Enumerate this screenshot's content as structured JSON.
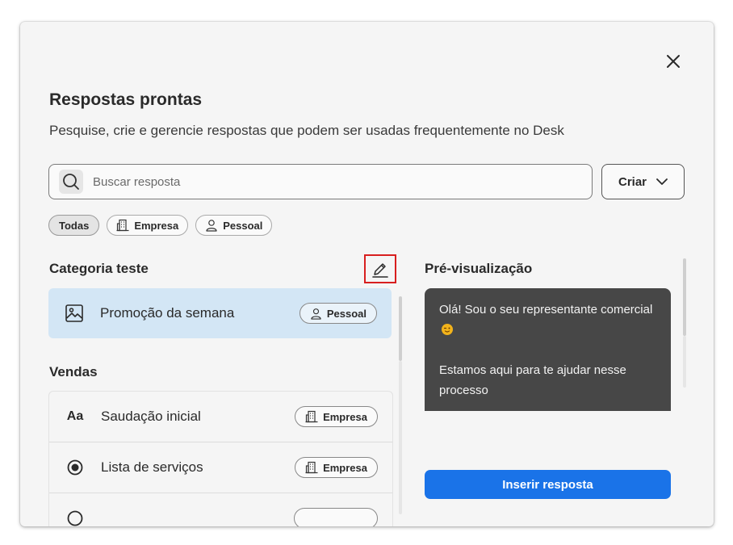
{
  "header": {
    "title": "Respostas prontas",
    "subtitle": "Pesquise, crie e gerencie respostas que podem ser usadas frequentemente no Desk"
  },
  "search": {
    "placeholder": "Buscar resposta",
    "value": ""
  },
  "create_button": {
    "label": "Criar"
  },
  "filters": [
    {
      "label": "Todas",
      "active": true
    },
    {
      "label": "Empresa",
      "icon": "building-icon"
    },
    {
      "label": "Pessoal",
      "icon": "person-icon"
    }
  ],
  "categories": [
    {
      "title": "Categoria teste",
      "items": [
        {
          "label": "Promoção da semana",
          "icon": "image-icon",
          "badge": "Pessoal",
          "badge_icon": "person-icon",
          "selected": true
        }
      ]
    },
    {
      "title": "Vendas",
      "items": [
        {
          "label": "Saudação inicial",
          "icon": "text-aa-icon",
          "badge": "Empresa",
          "badge_icon": "building-icon"
        },
        {
          "label": "Lista de serviços",
          "icon": "radio-icon",
          "badge": "Empresa",
          "badge_icon": "building-icon"
        }
      ]
    }
  ],
  "preview": {
    "title": "Pré-visualização",
    "paragraph1": "Olá! Sou o seu representante comercial",
    "paragraph2": "Estamos aqui para te ajudar nesse processo",
    "emoji_icon": "winking-face-icon"
  },
  "insert_button": {
    "label": "Inserir resposta"
  },
  "colors": {
    "accent": "#1a73e8",
    "selected_bg": "#d3e6f5",
    "preview_bg": "#474747",
    "highlight_border": "#d81f1f"
  }
}
